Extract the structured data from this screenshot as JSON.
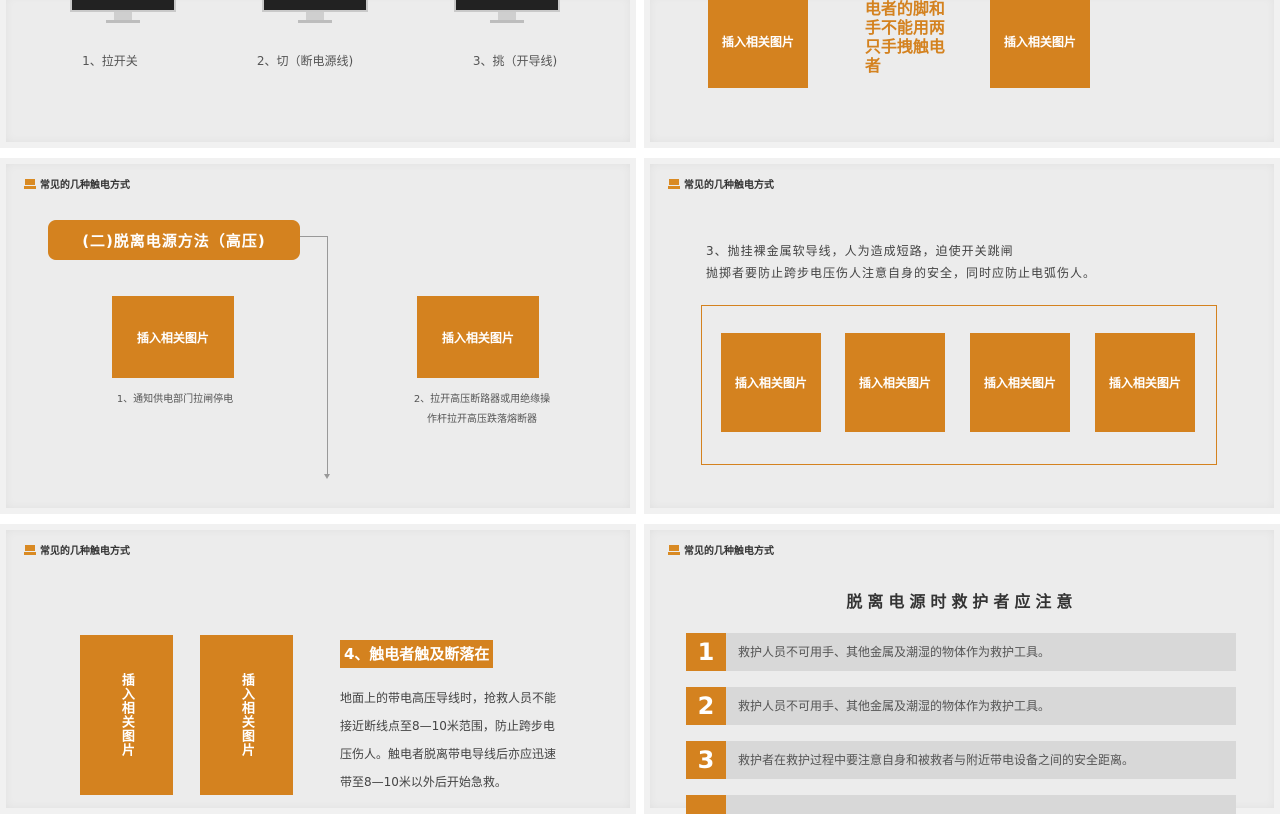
{
  "slides": {
    "header_title": "常见的几种触电方式",
    "placeholder_label": "插入相关图片",
    "s1": {
      "captions": [
        "1、拉开关",
        "2、切（断电源线)",
        "3、挑（开导线)"
      ]
    },
    "s2": {
      "lines": [
        "电者的脚和",
        "手不能用两",
        "只手拽触电",
        "者"
      ]
    },
    "s3": {
      "title": "(二)脱离电源方法（高压)",
      "caption1": "1、通知供电部门拉闸停电",
      "caption2_line1": "2、拉开高压断路器或用绝缘操",
      "caption2_line2": "作杆拉开高压跌落熔断器"
    },
    "s4": {
      "line1": "3、抛挂裸金属软导线，人为造成短路，迫使开关跳闸",
      "line2": "抛掷者要防止跨步电压伤人注意自身的安全，同时应防止电弧伤人。"
    },
    "s5": {
      "title": "4、触电者触及断落在",
      "p1": "地面上的带电高压导线时，抢救人员不能",
      "p2": "接近断线点至8—10米范围，防止跨步电",
      "p3": "压伤人。触电者脱离带电导线后亦应迅速",
      "p4": "带至8—10米以外后开始急救。"
    },
    "s6": {
      "title": "脱离电源时救护者应注意",
      "items": [
        {
          "num": "1",
          "text": "救护人员不可用手、其他金属及潮湿的物体作为救护工具。"
        },
        {
          "num": "2",
          "text": "救护人员不可用手、其他金属及潮湿的物体作为救护工具。"
        },
        {
          "num": "3",
          "text": "救护者在救护过程中要注意自身和被救者与附近带电设备之间的安全距离。"
        }
      ]
    }
  },
  "colors": {
    "accent": "#d4821f",
    "slide_bg": "#ececec",
    "row_bg": "#d8d8d8"
  }
}
